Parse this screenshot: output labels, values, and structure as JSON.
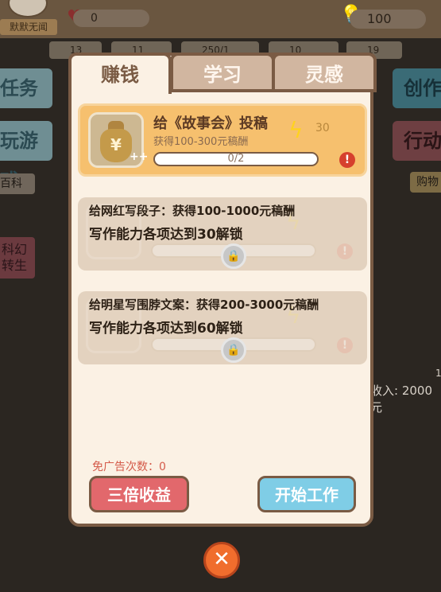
{
  "background": {
    "name_plate": "默默无闻",
    "hearts": "0",
    "coins": "100",
    "stats": [
      "13",
      "11",
      "250/1",
      "10",
      "19"
    ],
    "left_buttons": [
      "任务",
      "玩游戏"
    ],
    "wiki_label": "百科",
    "rebirth_label": "科幻\n转生",
    "right_buttons": [
      "创作",
      "行动"
    ],
    "shop_label": "购物",
    "income_text": "收入: 2000元",
    "income_one": "1"
  },
  "dialog": {
    "tabs": [
      {
        "label": "赚钱",
        "active": true
      },
      {
        "label": "学习",
        "active": false
      },
      {
        "label": "灵感",
        "active": false
      }
    ],
    "tasks": [
      {
        "title": "给《故事会》投稿",
        "subtitle": "获得100-300元稿酬",
        "cost": "30",
        "progress_text": "0/2",
        "progress_fraction": 0,
        "locked": false
      },
      {
        "title": "给网红写段子：获得100-1000元稿酬",
        "lock_desc": "写作能力各项达到30解锁",
        "locked": true
      },
      {
        "title": "给明星写围脖文案：获得200-3000元稿酬",
        "lock_desc": "写作能力各项达到60解锁",
        "locked": true
      }
    ],
    "free_ads_text": "免广告次数：0",
    "triple_button": "三倍收益",
    "start_button": "开始工作"
  },
  "icons": {
    "close": "close-icon",
    "energy": "lightning-icon",
    "lock": "lock-icon",
    "warning": "exclamation-icon"
  },
  "colors": {
    "accent_orange": "#f6c06e",
    "triple_red": "#e2686c",
    "start_blue": "#7fcde6",
    "close_orange": "#f06d2d"
  }
}
